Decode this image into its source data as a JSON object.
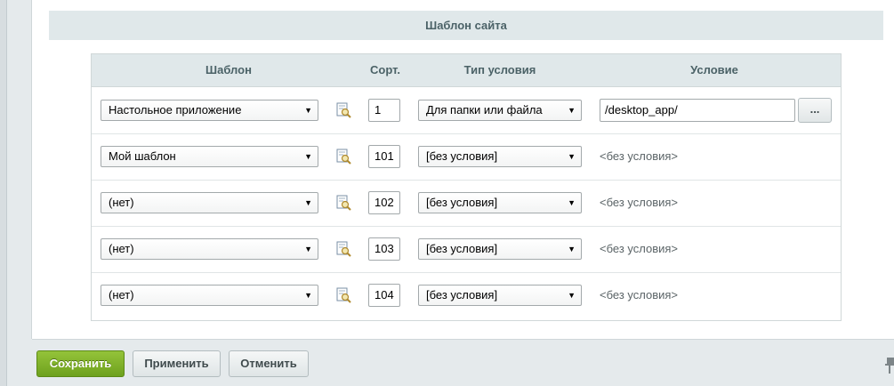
{
  "section": {
    "title": "Шаблон сайта"
  },
  "columns": {
    "template": "Шаблон",
    "sort": "Сорт.",
    "cond_type": "Тип условия",
    "condition": "Условие"
  },
  "rows": [
    {
      "template": "Настольное приложение",
      "sort": "1",
      "cond_type": "Для папки или файла",
      "condition": "/desktop_app/",
      "has_input": true
    },
    {
      "template": "Мой шаблон",
      "sort": "101",
      "cond_type": "[без условия]",
      "condition": "<без условия>",
      "has_input": false
    },
    {
      "template": "(нет)",
      "sort": "102",
      "cond_type": "[без условия]",
      "condition": "<без условия>",
      "has_input": false
    },
    {
      "template": "(нет)",
      "sort": "103",
      "cond_type": "[без условия]",
      "condition": "<без условия>",
      "has_input": false
    },
    {
      "template": "(нет)",
      "sort": "104",
      "cond_type": "[без условия]",
      "condition": "<без условия>",
      "has_input": false
    }
  ],
  "browse_label": "...",
  "buttons": {
    "save": "Сохранить",
    "apply": "Применить",
    "cancel": "Отменить"
  },
  "icons": {
    "row_edit": "edit-template-icon",
    "pin": "pin-icon",
    "dropdown": "chevron-down-icon"
  },
  "colors": {
    "save_green": "#7db02a",
    "header_bg": "#e0e8ea",
    "header_text": "#4b6267"
  }
}
